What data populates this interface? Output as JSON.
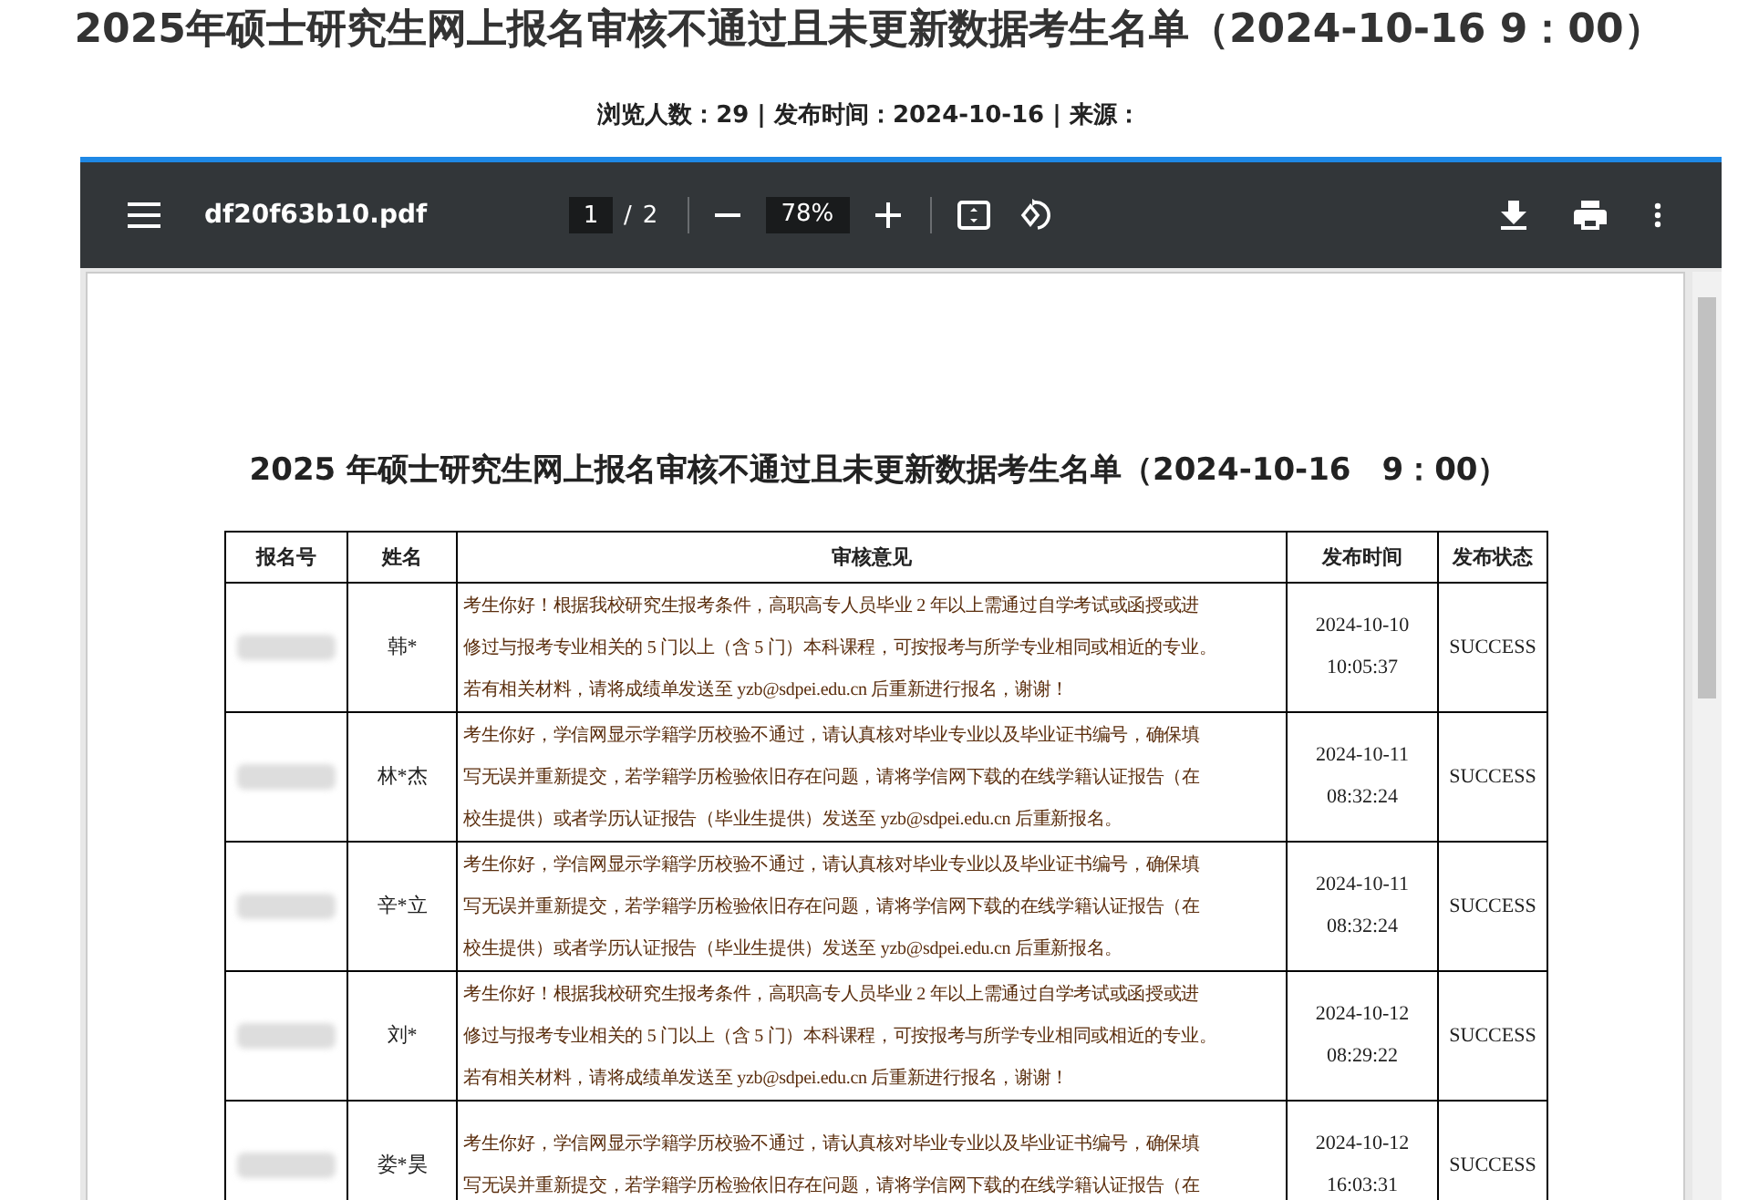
{
  "page_title": "2025年硕士研究生网上报名审核不通过且未更新数据考生名单（2024-10-16 9：00）",
  "meta": "浏览人数：29 | 发布时间：2024-10-16 | 来源：",
  "viewer": {
    "file_name": "df20f63b10.pdf",
    "page_current": "1",
    "page_sep": "/",
    "page_total": "2",
    "zoom": "78%",
    "document": {
      "title": "2025 年硕士研究生网上报名审核不通过且未更新数据考生名单（2024-10-16　9：00）",
      "table": {
        "columns": [
          "报名号",
          "姓名",
          "审核意见",
          "发布时间",
          "发布状态"
        ],
        "rows": [
          {
            "name": "韩*",
            "comment": [
              "考生你好！根据我校研究生报考条件，高职高专人员毕业 2 年以上需通过自学考试或函授或进",
              "修过与报考专业相关的 5 门以上（含 5 门）本科课程，可按报考与所学专业相同或相近的专业。",
              "若有相关材料，请将成绩单发送至 yzb@sdpei.edu.cn 后重新进行报名，谢谢！"
            ],
            "date": "2024-10-10",
            "time": "10:05:37",
            "status": "SUCCESS"
          },
          {
            "name": "林*杰",
            "comment": [
              "考生你好，学信网显示学籍学历校验不通过，请认真核对毕业专业以及毕业证书编号，确保填",
              "写无误并重新提交，若学籍学历检验依旧存在问题，请将学信网下载的在线学籍认证报告（在",
              "校生提供）或者学历认证报告（毕业生提供）发送至 yzb@sdpei.edu.cn 后重新报名。"
            ],
            "date": "2024-10-11",
            "time": "08:32:24",
            "status": "SUCCESS"
          },
          {
            "name": "辛*立",
            "comment": [
              "考生你好，学信网显示学籍学历校验不通过，请认真核对毕业专业以及毕业证书编号，确保填",
              "写无误并重新提交，若学籍学历检验依旧存在问题，请将学信网下载的在线学籍认证报告（在",
              "校生提供）或者学历认证报告（毕业生提供）发送至 yzb@sdpei.edu.cn 后重新报名。"
            ],
            "date": "2024-10-11",
            "time": "08:32:24",
            "status": "SUCCESS"
          },
          {
            "name": "刘*",
            "comment": [
              "考生你好！根据我校研究生报考条件，高职高专人员毕业 2 年以上需通过自学考试或函授或进",
              "修过与报考专业相关的 5 门以上（含 5 门）本科课程，可按报考与所学专业相同或相近的专业。",
              "若有相关材料，请将成绩单发送至 yzb@sdpei.edu.cn 后重新进行报名，谢谢！"
            ],
            "date": "2024-10-12",
            "time": "08:29:22",
            "status": "SUCCESS"
          },
          {
            "name": "娄*昊",
            "comment": [
              "考生你好，学信网显示学籍学历校验不通过，请认真核对毕业专业以及毕业证书编号，确保填",
              "写无误并重新提交，若学籍学历检验依旧存在问题，请将学信网下载的在线学籍认证报告（在"
            ],
            "date": "2024-10-12",
            "time": "16:03:31",
            "status": "SUCCESS"
          }
        ]
      }
    }
  }
}
